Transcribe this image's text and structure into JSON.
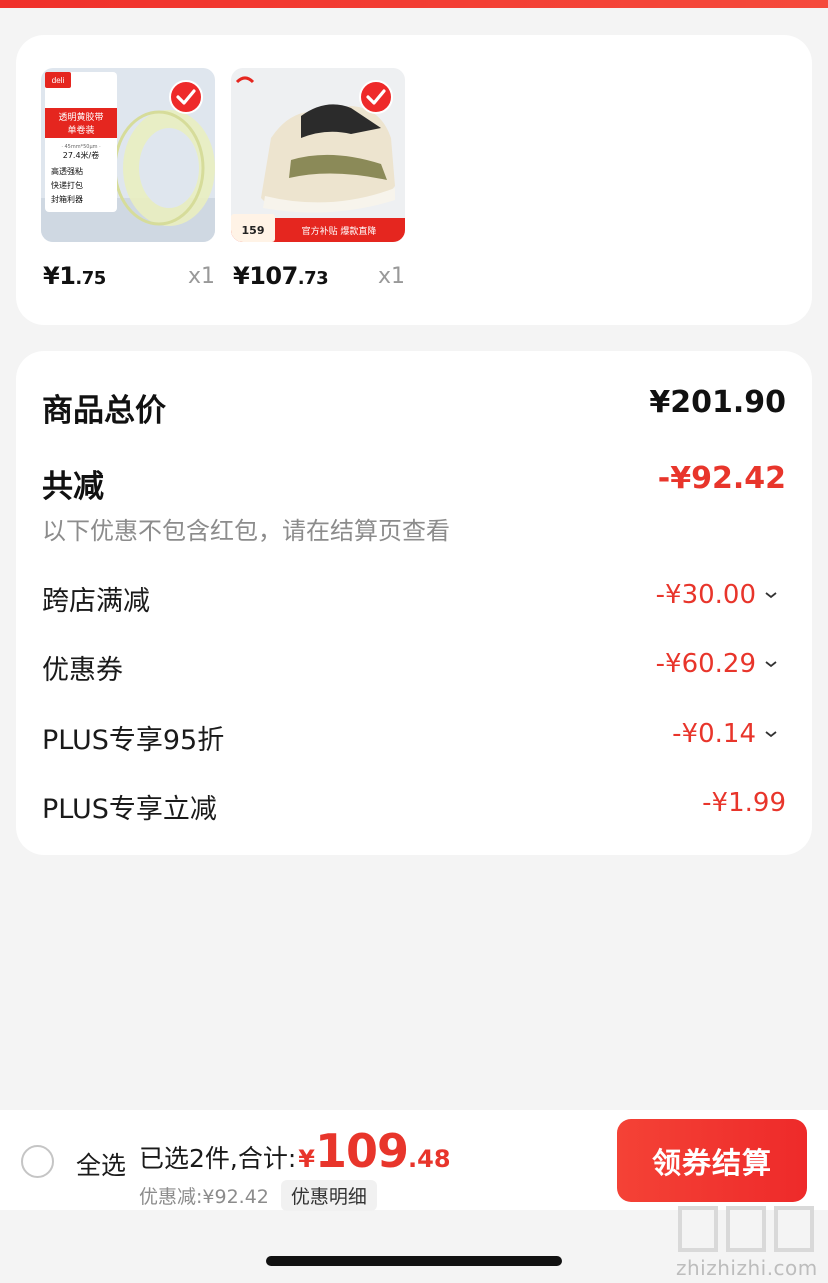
{
  "colors": {
    "accent": "#ee2a2a",
    "price_red": "#e8352b"
  },
  "products": [
    {
      "price_int": "¥1",
      "price_dec": ".75",
      "qty": "x1",
      "image": {
        "brand": "deli",
        "lines": [
          "透明黄胶带",
          "单卷装",
          "· 45mm*50μm ·",
          "27.4米/卷",
          "高透强粘",
          "快递打包",
          "封箱利器"
        ]
      }
    },
    {
      "price_int": "¥107",
      "price_dec": ".73",
      "qty": "x1",
      "image": {
        "tag_price": "159",
        "banner": "官方补贴 爆款直降"
      }
    }
  ],
  "summary": {
    "total_label": "商品总价",
    "total_value": "¥201.90",
    "reduce_label": "共减",
    "reduce_value": "-¥92.42",
    "note": "以下优惠不包含红包，请在结算页查看",
    "items": [
      {
        "label": "跨店满减",
        "value": "-¥30.00",
        "expandable": true
      },
      {
        "label": "优惠券",
        "value": "-¥60.29",
        "expandable": true
      },
      {
        "label": "PLUS专享95折",
        "value": "-¥0.14",
        "expandable": true
      },
      {
        "label": "PLUS专享立减",
        "value": "-¥1.99",
        "expandable": false
      }
    ]
  },
  "bottom": {
    "select_all": "全选",
    "selected_prefix": "已选2件,合计:",
    "total_yen": "¥",
    "total_int": "109",
    "total_dec": ".48",
    "saved": "优惠减:¥92.42",
    "detail": "优惠明细",
    "checkout": "领券结算"
  },
  "watermark": {
    "text": "zhizhizhi.com"
  }
}
